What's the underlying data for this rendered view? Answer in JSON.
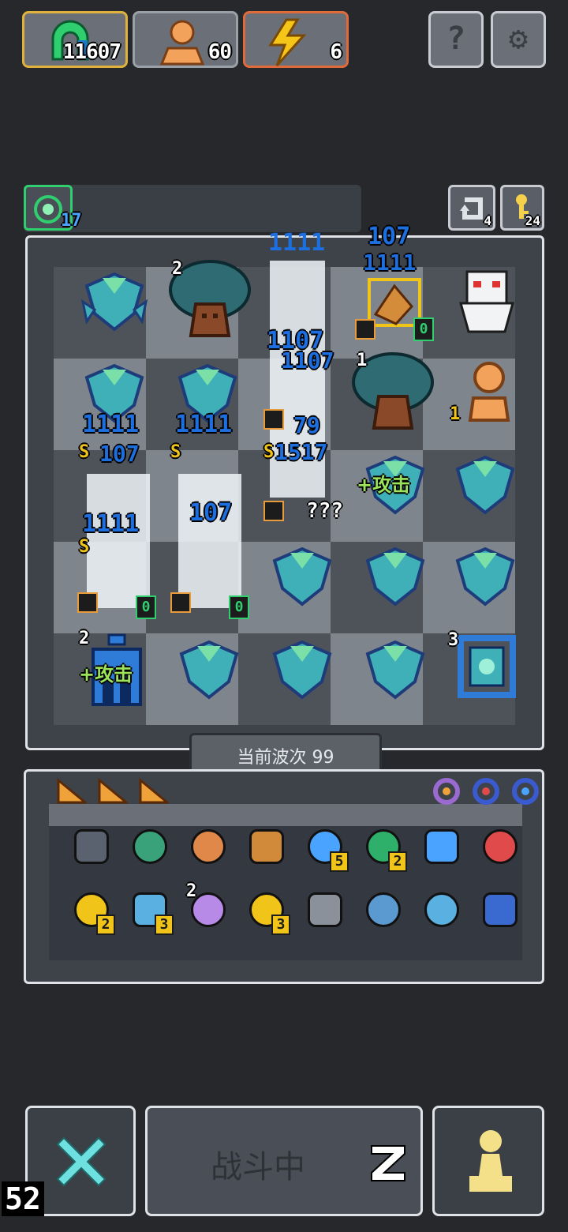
{
  "resources": {
    "gems": "11607",
    "population": "60",
    "energy": "6"
  },
  "top_buttons": {
    "help": "?",
    "settings": "⚙"
  },
  "boss_bar": {
    "level": "17",
    "undo_count": "4",
    "key_count": "24"
  },
  "damage_popups": {
    "p1": "1111",
    "p2": "107",
    "p3": "1111",
    "p4": "1107",
    "p5": "1111",
    "p6": "107",
    "p7": "1111",
    "p8": "1107",
    "p9": "79",
    "p10": "1517",
    "p11": "1111",
    "p12": "107",
    "hidden": "???"
  },
  "board_labels": {
    "tree_level_1": "2",
    "tree_level_2": "1",
    "statue_level": "1",
    "buff_attack": "+攻击",
    "buff_attack_2": "+攻击",
    "tower_level": "2",
    "portal_level": "3",
    "marker_s": "S",
    "marker_zero": "0"
  },
  "wave": {
    "label": "当前波次 99"
  },
  "inventory": {
    "items": [
      {
        "icon": "shield-icon",
        "count": ""
      },
      {
        "icon": "helmet-icon",
        "count": ""
      },
      {
        "icon": "armor-icon",
        "count": ""
      },
      {
        "icon": "butterfly-orb-icon",
        "count": ""
      },
      {
        "icon": "planet-icon",
        "count": "5"
      },
      {
        "icon": "boot-icon",
        "count": "2"
      },
      {
        "icon": "gear-icon",
        "count": ""
      },
      {
        "icon": "potion-icon",
        "count": ""
      },
      {
        "icon": "ring-icon",
        "count": "2"
      },
      {
        "icon": "windmill-icon",
        "count": "3"
      },
      {
        "icon": "spark-icon",
        "count": ""
      },
      {
        "icon": "grid-chip-icon",
        "count": "3"
      },
      {
        "icon": "heart-plate-icon",
        "count": ""
      },
      {
        "icon": "antenna-icon",
        "count": ""
      },
      {
        "icon": "dagger-icon",
        "count": ""
      },
      {
        "icon": "blue-coin-icon",
        "count": ""
      }
    ],
    "spark_level": "2"
  },
  "bottom": {
    "battle_label": "战斗中",
    "corner_number": "52"
  },
  "colors": {
    "teal": "#5ec8b5",
    "gold": "#f0c419",
    "blue_damage": "#1d6fe0",
    "energy_orange": "#e06a3a"
  }
}
